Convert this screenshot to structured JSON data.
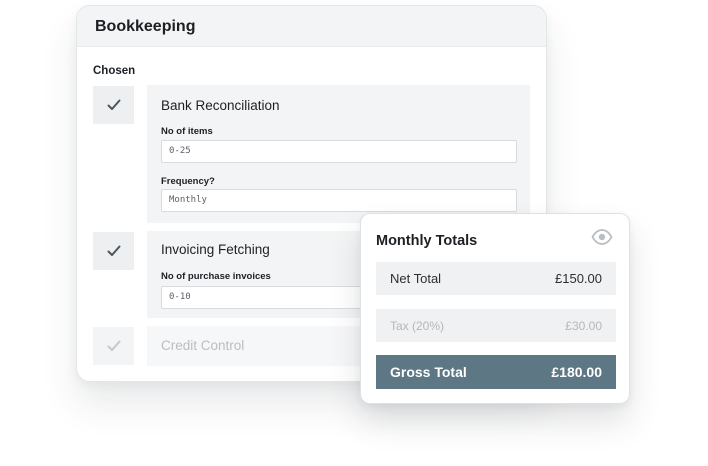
{
  "bookkeeping": {
    "title": "Bookkeeping",
    "section_label": "Chosen",
    "services": [
      {
        "title": "Bank Reconciliation",
        "checked": true,
        "fields": [
          {
            "label": "No of items",
            "value": "0-25"
          },
          {
            "label": "Frequency?",
            "value": "Monthly"
          }
        ]
      },
      {
        "title": "Invoicing Fetching",
        "checked": true,
        "fields": [
          {
            "label": "No of purchase invoices",
            "value": "0-10"
          }
        ]
      },
      {
        "title": "Credit Control",
        "checked": false,
        "fields": []
      }
    ]
  },
  "totals": {
    "title": "Monthly Totals",
    "icon": "eye-icon",
    "net_label": "Net Total",
    "net_value": "£150.00",
    "tax_label": "Tax (20%)",
    "tax_value": "£30.00",
    "gross_label": "Gross Total",
    "gross_value": "£180.00"
  },
  "colors": {
    "accent": "#5e7784",
    "panel": "#f3f4f5",
    "check": "#4a5560",
    "check_faded": "#c3c8cc"
  }
}
